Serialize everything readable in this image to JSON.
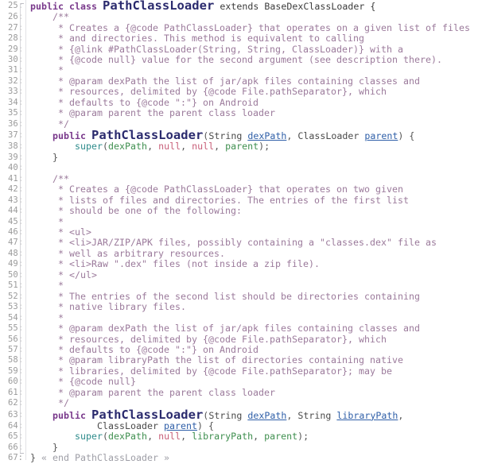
{
  "editor": {
    "type": "code-editor",
    "language": "java",
    "first_line_number": 25,
    "last_line_number": 67,
    "background": "#ffffff",
    "gutter_color": "#9a9a9a",
    "colors": {
      "keyword": "#7a3a8c",
      "class_name": "#2b2b6e",
      "comment": "#9b7a9b",
      "parameter": "#3f7f3f",
      "parameter_underlined": "#2f5fa8",
      "null_literal": "#c8607a",
      "method_call": "#2e8b8b",
      "plain_text": "#3b3b3b",
      "fold_annotation": "#9e9ea6"
    },
    "fold_annotation": "« end PathClassLoader »"
  },
  "lines": [
    {
      "n": "25",
      "big": true,
      "tokens": [
        {
          "t": "public ",
          "c": "kw"
        },
        {
          "t": "class ",
          "c": "kw"
        },
        {
          "t": "PathClassLoader",
          "c": "clsname"
        },
        {
          "t": " extends BaseDexClassLoader {",
          "c": "plain"
        }
      ]
    },
    {
      "n": "26",
      "tokens": [
        {
          "t": "    /**",
          "c": "cmt"
        }
      ]
    },
    {
      "n": "27",
      "tokens": [
        {
          "t": "     * Creates a {@code PathClassLoader} that operates on a given list of files",
          "c": "cmt"
        }
      ]
    },
    {
      "n": "28",
      "tokens": [
        {
          "t": "     * and directories. This method is equivalent to calling",
          "c": "cmt"
        }
      ]
    },
    {
      "n": "29",
      "tokens": [
        {
          "t": "     * {@link #PathClassLoader(String, String, ClassLoader)} with a",
          "c": "cmt"
        }
      ]
    },
    {
      "n": "30",
      "tokens": [
        {
          "t": "     * {@code null} value for the second argument (see description there).",
          "c": "cmt"
        }
      ]
    },
    {
      "n": "31",
      "tokens": [
        {
          "t": "     *",
          "c": "cmt"
        }
      ]
    },
    {
      "n": "32",
      "tokens": [
        {
          "t": "     * @param dexPath the list of jar/apk files containing classes and",
          "c": "cmt"
        }
      ]
    },
    {
      "n": "33",
      "tokens": [
        {
          "t": "     * resources, delimited by {@code File.pathSeparator}, which",
          "c": "cmt"
        }
      ]
    },
    {
      "n": "34",
      "tokens": [
        {
          "t": "     * defaults to {@code \":\"} on Android",
          "c": "cmt"
        }
      ]
    },
    {
      "n": "35",
      "tokens": [
        {
          "t": "     * @param parent the parent class loader",
          "c": "cmt"
        }
      ]
    },
    {
      "n": "36",
      "tokens": [
        {
          "t": "     */",
          "c": "cmt"
        }
      ]
    },
    {
      "n": "37",
      "big": true,
      "tokens": [
        {
          "t": "    public ",
          "c": "kw"
        },
        {
          "t": "PathClassLoader",
          "c": "clsname"
        },
        {
          "t": "(",
          "c": "punct"
        },
        {
          "t": "String ",
          "c": "type"
        },
        {
          "t": "dexPath",
          "c": "paramu"
        },
        {
          "t": ", ",
          "c": "punct"
        },
        {
          "t": "ClassLoader ",
          "c": "type"
        },
        {
          "t": "parent",
          "c": "paramu"
        },
        {
          "t": ") {",
          "c": "punct"
        }
      ]
    },
    {
      "n": "38",
      "tokens": [
        {
          "t": "        ",
          "c": "plain"
        },
        {
          "t": "super",
          "c": "call"
        },
        {
          "t": "(",
          "c": "punct"
        },
        {
          "t": "dexPath",
          "c": "ident"
        },
        {
          "t": ", ",
          "c": "punct"
        },
        {
          "t": "null",
          "c": "nul"
        },
        {
          "t": ", ",
          "c": "punct"
        },
        {
          "t": "null",
          "c": "nul"
        },
        {
          "t": ", ",
          "c": "punct"
        },
        {
          "t": "parent",
          "c": "ident"
        },
        {
          "t": ");",
          "c": "punct"
        }
      ]
    },
    {
      "n": "39",
      "tokens": [
        {
          "t": "    }",
          "c": "punct"
        }
      ]
    },
    {
      "n": "40",
      "tokens": [
        {
          "t": "",
          "c": "plain"
        }
      ]
    },
    {
      "n": "41",
      "tokens": [
        {
          "t": "    /**",
          "c": "cmt"
        }
      ]
    },
    {
      "n": "42",
      "tokens": [
        {
          "t": "     * Creates a {@code PathClassLoader} that operates on two given",
          "c": "cmt"
        }
      ]
    },
    {
      "n": "43",
      "tokens": [
        {
          "t": "     * lists of files and directories. The entries of the first list",
          "c": "cmt"
        }
      ]
    },
    {
      "n": "44",
      "tokens": [
        {
          "t": "     * should be one of the following:",
          "c": "cmt"
        }
      ]
    },
    {
      "n": "45",
      "tokens": [
        {
          "t": "     *",
          "c": "cmt"
        }
      ]
    },
    {
      "n": "46",
      "tokens": [
        {
          "t": "     * <ul>",
          "c": "cmt"
        }
      ]
    },
    {
      "n": "47",
      "tokens": [
        {
          "t": "     * <li>JAR/ZIP/APK files, possibly containing a \"classes.dex\" file as",
          "c": "cmt"
        }
      ]
    },
    {
      "n": "48",
      "tokens": [
        {
          "t": "     * well as arbitrary resources.",
          "c": "cmt"
        }
      ]
    },
    {
      "n": "49",
      "tokens": [
        {
          "t": "     * <li>Raw \".dex\" files (not inside a zip file).",
          "c": "cmt"
        }
      ]
    },
    {
      "n": "50",
      "tokens": [
        {
          "t": "     * </ul>",
          "c": "cmt"
        }
      ]
    },
    {
      "n": "51",
      "tokens": [
        {
          "t": "     *",
          "c": "cmt"
        }
      ]
    },
    {
      "n": "52",
      "tokens": [
        {
          "t": "     * The entries of the second list should be directories containing",
          "c": "cmt"
        }
      ]
    },
    {
      "n": "53",
      "tokens": [
        {
          "t": "     * native library files.",
          "c": "cmt"
        }
      ]
    },
    {
      "n": "54",
      "tokens": [
        {
          "t": "     *",
          "c": "cmt"
        }
      ]
    },
    {
      "n": "55",
      "tokens": [
        {
          "t": "     * @param dexPath the list of jar/apk files containing classes and",
          "c": "cmt"
        }
      ]
    },
    {
      "n": "56",
      "tokens": [
        {
          "t": "     * resources, delimited by {@code File.pathSeparator}, which",
          "c": "cmt"
        }
      ]
    },
    {
      "n": "57",
      "tokens": [
        {
          "t": "     * defaults to {@code \":\"} on Android",
          "c": "cmt"
        }
      ]
    },
    {
      "n": "58",
      "tokens": [
        {
          "t": "     * @param libraryPath the list of directories containing native",
          "c": "cmt"
        }
      ]
    },
    {
      "n": "59",
      "tokens": [
        {
          "t": "     * libraries, delimited by {@code File.pathSeparator}; may be",
          "c": "cmt"
        }
      ]
    },
    {
      "n": "60",
      "tokens": [
        {
          "t": "     * {@code null}",
          "c": "cmt"
        }
      ]
    },
    {
      "n": "61",
      "tokens": [
        {
          "t": "     * @param parent the parent class loader",
          "c": "cmt"
        }
      ]
    },
    {
      "n": "62",
      "tokens": [
        {
          "t": "     */",
          "c": "cmt"
        }
      ]
    },
    {
      "n": "63",
      "big": true,
      "tokens": [
        {
          "t": "    public ",
          "c": "kw"
        },
        {
          "t": "PathClassLoader",
          "c": "clsname"
        },
        {
          "t": "(",
          "c": "punct"
        },
        {
          "t": "String ",
          "c": "type"
        },
        {
          "t": "dexPath",
          "c": "paramu"
        },
        {
          "t": ", ",
          "c": "punct"
        },
        {
          "t": "String ",
          "c": "type"
        },
        {
          "t": "libraryPath",
          "c": "paramu"
        },
        {
          "t": ",",
          "c": "punct"
        }
      ]
    },
    {
      "n": "64",
      "tokens": [
        {
          "t": "            ",
          "c": "plain"
        },
        {
          "t": "ClassLoader ",
          "c": "type"
        },
        {
          "t": "parent",
          "c": "paramu"
        },
        {
          "t": ") {",
          "c": "punct"
        }
      ]
    },
    {
      "n": "65",
      "tokens": [
        {
          "t": "        ",
          "c": "plain"
        },
        {
          "t": "super",
          "c": "call"
        },
        {
          "t": "(",
          "c": "punct"
        },
        {
          "t": "dexPath",
          "c": "ident"
        },
        {
          "t": ", ",
          "c": "punct"
        },
        {
          "t": "null",
          "c": "nul"
        },
        {
          "t": ", ",
          "c": "punct"
        },
        {
          "t": "libraryPath",
          "c": "ident"
        },
        {
          "t": ", ",
          "c": "punct"
        },
        {
          "t": "parent",
          "c": "ident"
        },
        {
          "t": ");",
          "c": "punct"
        }
      ]
    },
    {
      "n": "66",
      "tokens": [
        {
          "t": "    }",
          "c": "punct"
        }
      ]
    },
    {
      "n": "67",
      "tokens": [
        {
          "t": "}",
          "c": "punct"
        },
        {
          "t": " « end PathClassLoader »",
          "c": "fold-note"
        }
      ]
    }
  ]
}
